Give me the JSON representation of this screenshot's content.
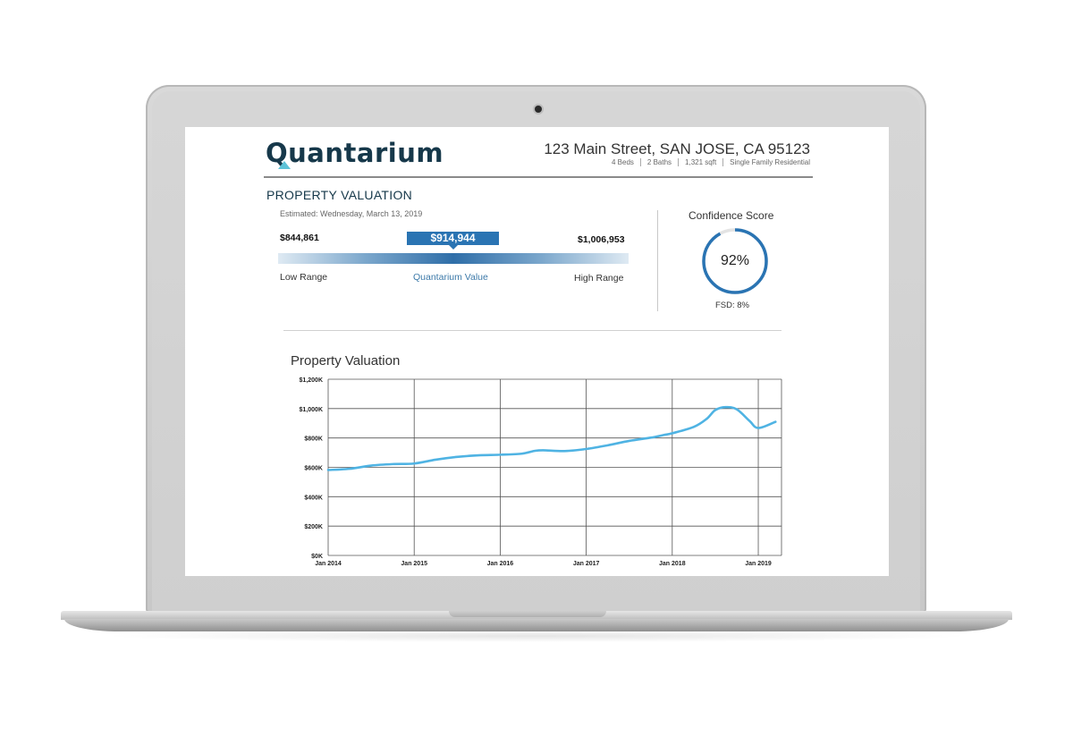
{
  "report": {
    "logo_text": "Quantarium",
    "address": "123 Main Street, SAN JOSE, CA 95123",
    "facts": [
      "4 Beds",
      "2 Baths",
      "1,321 sqft",
      "Single Family Residential"
    ]
  },
  "valuation": {
    "section_title": "PROPERTY VALUATION",
    "estimated": "Estimated: Wednesday, March 13, 2019",
    "low_value": "$844,861",
    "value": "$914,944",
    "high_value": "$1,006,953",
    "low_label": "Low Range",
    "value_label": "Quantarium Value",
    "high_label": "High Range"
  },
  "confidence": {
    "title": "Confidence Score",
    "score_text": "92%",
    "score_fraction": 0.92,
    "fsd_text": "FSD: 8%"
  },
  "colors": {
    "brand": "#16384a",
    "accent": "#2a74b3",
    "line": "#4fb3e3",
    "logo_chevron": "#5ec3d8"
  },
  "chart_data": {
    "type": "line",
    "title": "Property Valuation",
    "xlabel": "",
    "ylabel": "",
    "x_ticks": [
      "Jan 2014",
      "Jan 2015",
      "Jan 2016",
      "Jan 2017",
      "Jan 2018",
      "Jan 2019"
    ],
    "y_ticks": [
      "$0K",
      "$200K",
      "$400K",
      "$600K",
      "$800K",
      "$1,000K",
      "$1,200K"
    ],
    "ylim": [
      0,
      1200
    ],
    "xlim": [
      2014.0,
      2019.27
    ],
    "grid": true,
    "series": [
      {
        "x": [
          2014.0,
          2014.25,
          2014.5,
          2014.75,
          2015.0,
          2015.25,
          2015.5,
          2015.75,
          2016.0,
          2016.25,
          2016.4,
          2016.5,
          2016.75,
          2017.0,
          2017.25,
          2017.5,
          2017.75,
          2017.9,
          2018.0,
          2018.25,
          2018.4,
          2018.5,
          2018.62,
          2018.75,
          2018.9,
          2019.0,
          2019.2
        ],
        "values": [
          582,
          590,
          612,
          622,
          626,
          652,
          671,
          682,
          686,
          693,
          712,
          716,
          711,
          725,
          750,
          780,
          802,
          820,
          832,
          875,
          930,
          990,
          1010,
          995,
          915,
          868,
          910
        ]
      }
    ]
  }
}
